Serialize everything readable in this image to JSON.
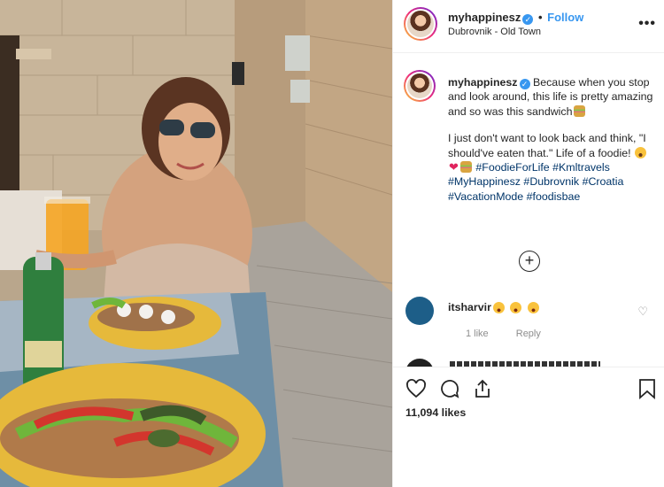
{
  "post": {
    "username": "myhappinesz",
    "follow_label": "Follow",
    "separator": "•",
    "location": "Dubrovnik - Old Town",
    "more_icon": "more-horizontal-icon"
  },
  "caption": {
    "username": "myhappinesz",
    "text_1": "Because when you stop and look around, this life is pretty amazing and so was this sandwich",
    "text_2": "I just don't want to look back and think, \"I should've eaten that.\" Life of a foodie!",
    "hashtags": [
      "#FoodieForLife",
      "#Kmltravels",
      "#MyHappinesz",
      "#Dubrovnik",
      "#Croatia",
      "#VacationMode",
      "#foodisbae"
    ]
  },
  "load_more_icon": "plus-circle-icon",
  "comments": [
    {
      "username": "itsharvir",
      "emojis": [
        "star-struck",
        "star-struck",
        "star-struck"
      ],
      "likes": "1 like",
      "reply": "Reply"
    }
  ],
  "actions": {
    "like_icon": "heart-icon",
    "comment_icon": "comment-icon",
    "share_icon": "share-icon",
    "save_icon": "bookmark-icon",
    "likes": "11,094 likes"
  },
  "colors": {
    "link": "#3897f0",
    "hashtag": "#003569",
    "muted": "#8e8e8e",
    "border": "#efefef"
  }
}
